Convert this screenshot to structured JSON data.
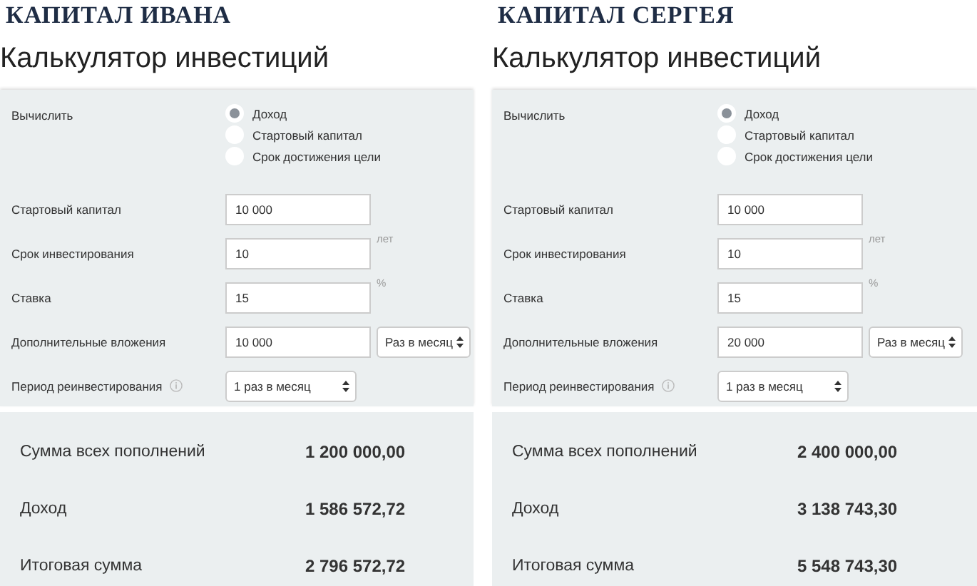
{
  "panels": [
    {
      "heading": "КАПИТАЛ ИВАНА",
      "title": "Калькулятор инвестиций",
      "calc": {
        "label": "Вычислить",
        "options": [
          {
            "label": "Доход",
            "selected": true
          },
          {
            "label": "Стартовый капитал",
            "selected": false
          },
          {
            "label": "Срок достижения цели",
            "selected": false
          }
        ]
      },
      "fields": [
        {
          "kind": "input",
          "label": "Стартовый капитал",
          "value": "10 000"
        },
        {
          "kind": "input",
          "label": "Срок инвестирования",
          "value": "10",
          "unit": "лет"
        },
        {
          "kind": "input",
          "label": "Ставка",
          "value": "15",
          "unit": "%"
        },
        {
          "kind": "input_select",
          "label": "Дополнительные вложения",
          "value": "10 000",
          "option": "Раз в месяц"
        },
        {
          "kind": "select_info",
          "label": "Период реинвестирования",
          "option": "1 раз в месяц"
        }
      ],
      "results": [
        {
          "label": "Сумма всех пополнений",
          "value": "1 200 000,00"
        },
        {
          "label": "Доход",
          "value": "1 586 572,72"
        },
        {
          "label": "Итоговая сумма",
          "value": "2 796 572,72"
        }
      ]
    },
    {
      "heading": "КАПИТАЛ СЕРГЕЯ",
      "title": "Калькулятор инвестиций",
      "calc": {
        "label": "Вычислить",
        "options": [
          {
            "label": "Доход",
            "selected": true
          },
          {
            "label": "Стартовый капитал",
            "selected": false
          },
          {
            "label": "Срок достижения цели",
            "selected": false
          }
        ]
      },
      "fields": [
        {
          "kind": "input",
          "label": "Стартовый капитал",
          "value": "10 000"
        },
        {
          "kind": "input",
          "label": "Срок инвестирования",
          "value": "10",
          "unit": "лет"
        },
        {
          "kind": "input",
          "label": "Ставка",
          "value": "15",
          "unit": "%"
        },
        {
          "kind": "input_select",
          "label": "Дополнительные вложения",
          "value": "20 000",
          "option": "Раз в месяц"
        },
        {
          "kind": "select_info",
          "label": "Период реинвестирования",
          "option": "1 раз в месяц"
        }
      ],
      "results": [
        {
          "label": "Сумма всех пополнений",
          "value": "2 400 000,00"
        },
        {
          "label": "Доход",
          "value": "3 138 743,30"
        },
        {
          "label": "Итоговая сумма",
          "value": "5 548 743,30"
        }
      ]
    }
  ]
}
